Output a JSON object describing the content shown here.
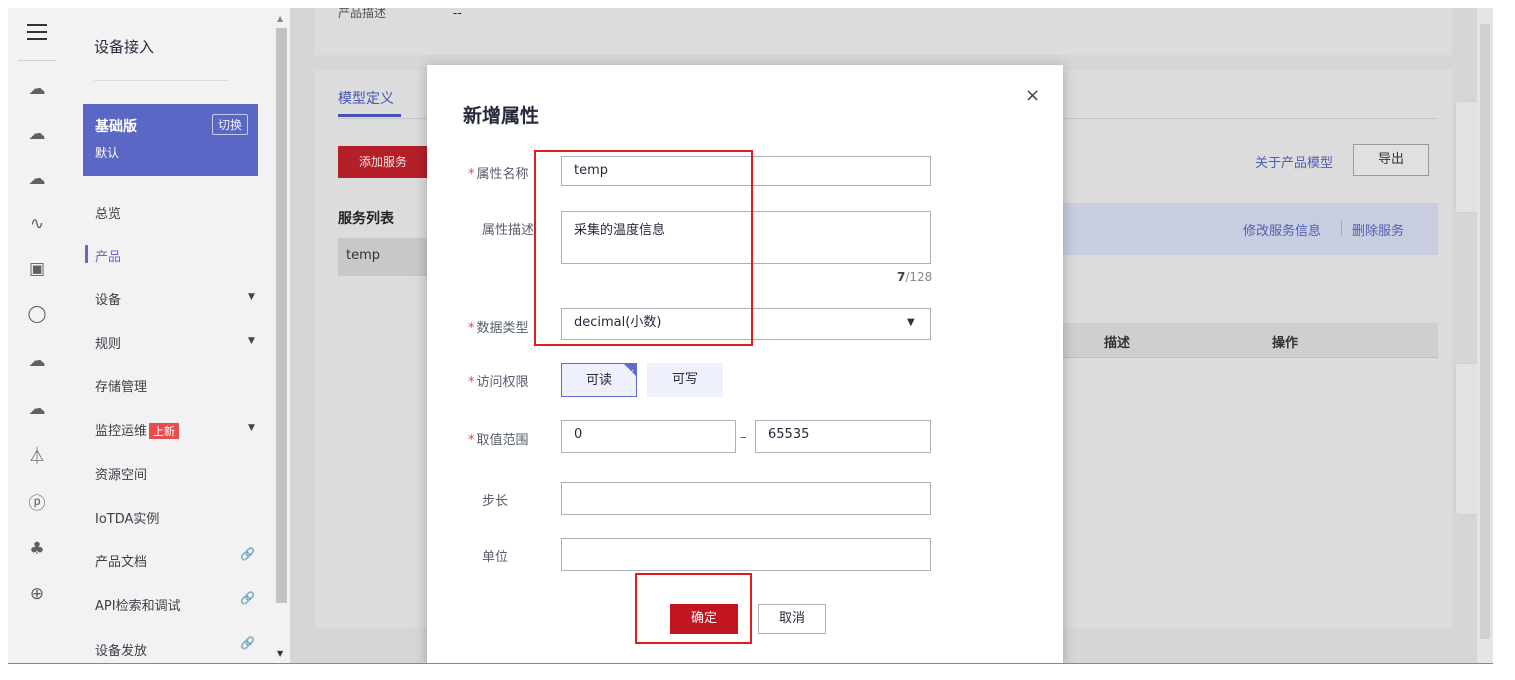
{
  "sidebar": {
    "title": "设备接入",
    "edition_name": "基础版",
    "edition_desc": "默认",
    "switch_label": "切换",
    "items": [
      {
        "label": "总览"
      },
      {
        "label": "产品"
      },
      {
        "label": "设备"
      },
      {
        "label": "规则"
      },
      {
        "label": "存储管理"
      },
      {
        "label": "监控运维"
      },
      {
        "label": "资源空间"
      },
      {
        "label": "IoTDA实例"
      },
      {
        "label": "产品文档"
      },
      {
        "label": "API检索和调试"
      },
      {
        "label": "设备发放"
      }
    ],
    "new_badge": "上新"
  },
  "background": {
    "product_desc_label": "产品描述",
    "product_desc_value": "--",
    "tab_model": "模型定义",
    "add_service_label": "添加服务",
    "about_model_link": "关于产品模型",
    "export_label": "导出",
    "service_list_label": "服务列表",
    "service_item": "temp",
    "edit_service_link": "修改服务信息",
    "delete_service_link": "删除服务",
    "col_desc": "描述",
    "col_ops": "操作"
  },
  "dialog": {
    "title": "新增属性",
    "close_glyph": "×",
    "name_label": "属性名称",
    "name_value": "temp",
    "desc_label": "属性描述",
    "desc_value": "采集的温度信息",
    "desc_count": "7",
    "desc_max": "/128",
    "type_label": "数据类型",
    "type_value": "decimal(小数)",
    "access_label": "访问权限",
    "access_read": "可读",
    "access_write": "可写",
    "range_label": "取值范围",
    "range_min": "0",
    "range_sep": "–",
    "range_max": "65535",
    "step_label": "步长",
    "step_value": "",
    "unit_label": "单位",
    "unit_value": "",
    "ok_label": "确定",
    "cancel_label": "取消"
  },
  "colors": {
    "accent": "#5e6ad2",
    "primary_red": "#c1161f",
    "highlight_box": "#e01d1d",
    "required_star": "#e5484d"
  },
  "icons": {
    "menu": "hamburger-icon",
    "close": "close-icon",
    "select_caret": "chevron-down-icon",
    "link": "link-icon"
  }
}
